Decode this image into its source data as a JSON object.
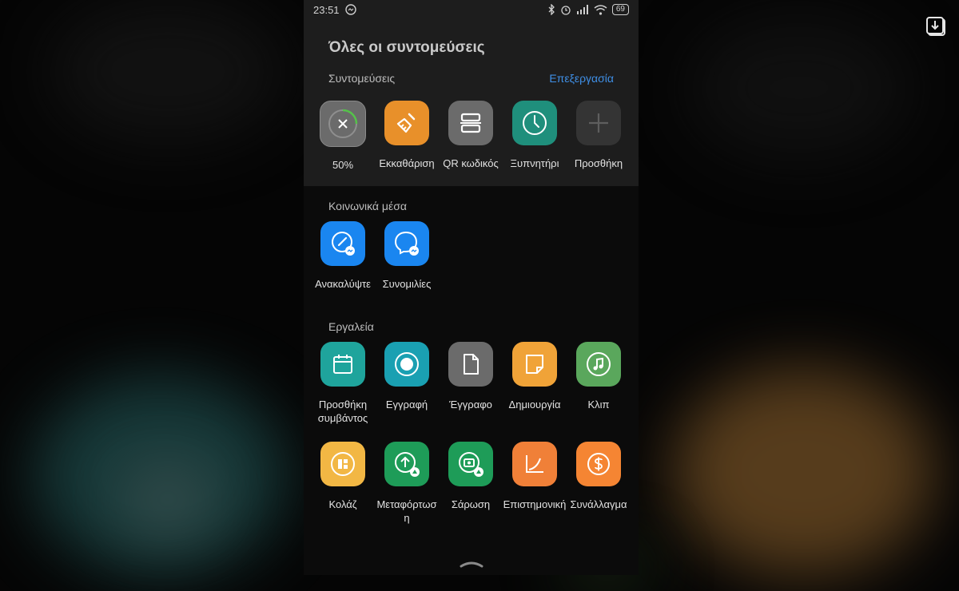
{
  "status_bar": {
    "time": "23:51",
    "battery": "69"
  },
  "header": {
    "title": "Όλες οι συντομεύσεις"
  },
  "shortcuts": {
    "label": "Συντομεύσεις",
    "edit": "Επεξεργασία",
    "items": [
      {
        "label": "50%",
        "icon": "close-icon",
        "color": "#6b6b6b"
      },
      {
        "label": "Εκκαθάριση",
        "icon": "broom-icon",
        "color": "#e8902a"
      },
      {
        "label": "QR κωδικός",
        "icon": "qr-scan-icon",
        "color": "#6b6b6b"
      },
      {
        "label": "Ξυπνητήρι",
        "icon": "clock-icon",
        "color": "#1f8f7c"
      },
      {
        "label": "Προσθήκη",
        "icon": "plus-icon",
        "color": "#343434"
      }
    ]
  },
  "social": {
    "label": "Κοινωνικά μέσα",
    "items": [
      {
        "label": "Ανακαλύψτε",
        "icon": "messenger-discover-icon",
        "color": "#1a86f0"
      },
      {
        "label": "Συνομιλίες",
        "icon": "messenger-chats-icon",
        "color": "#1a86f0"
      }
    ]
  },
  "tools": {
    "label": "Εργαλεία",
    "row1": [
      {
        "label": "Προσθήκη συμβάντος",
        "icon": "calendar-icon",
        "color": "#1fa49c"
      },
      {
        "label": "Εγγραφή",
        "icon": "record-icon",
        "color": "#1aa0b2"
      },
      {
        "label": "Έγγραφο",
        "icon": "document-icon",
        "color": "#6b6b6b"
      },
      {
        "label": "Δημιουργία",
        "icon": "note-icon",
        "color": "#f0a338"
      },
      {
        "label": "Κλιπ",
        "icon": "music-icon",
        "color": "#5aa75c"
      }
    ],
    "row2": [
      {
        "label": "Κολάζ",
        "icon": "collage-icon",
        "color": "#f2b744"
      },
      {
        "label": "Μεταφόρτωση",
        "icon": "drive-upload-icon",
        "color": "#1e9c58"
      },
      {
        "label": "Σάρωση",
        "icon": "drive-scan-icon",
        "color": "#1e9c58"
      },
      {
        "label": "Επιστημονική",
        "icon": "graph-icon",
        "color": "#f08038"
      },
      {
        "label": "Συνάλλαγμα",
        "icon": "currency-icon",
        "color": "#f58533"
      }
    ]
  }
}
